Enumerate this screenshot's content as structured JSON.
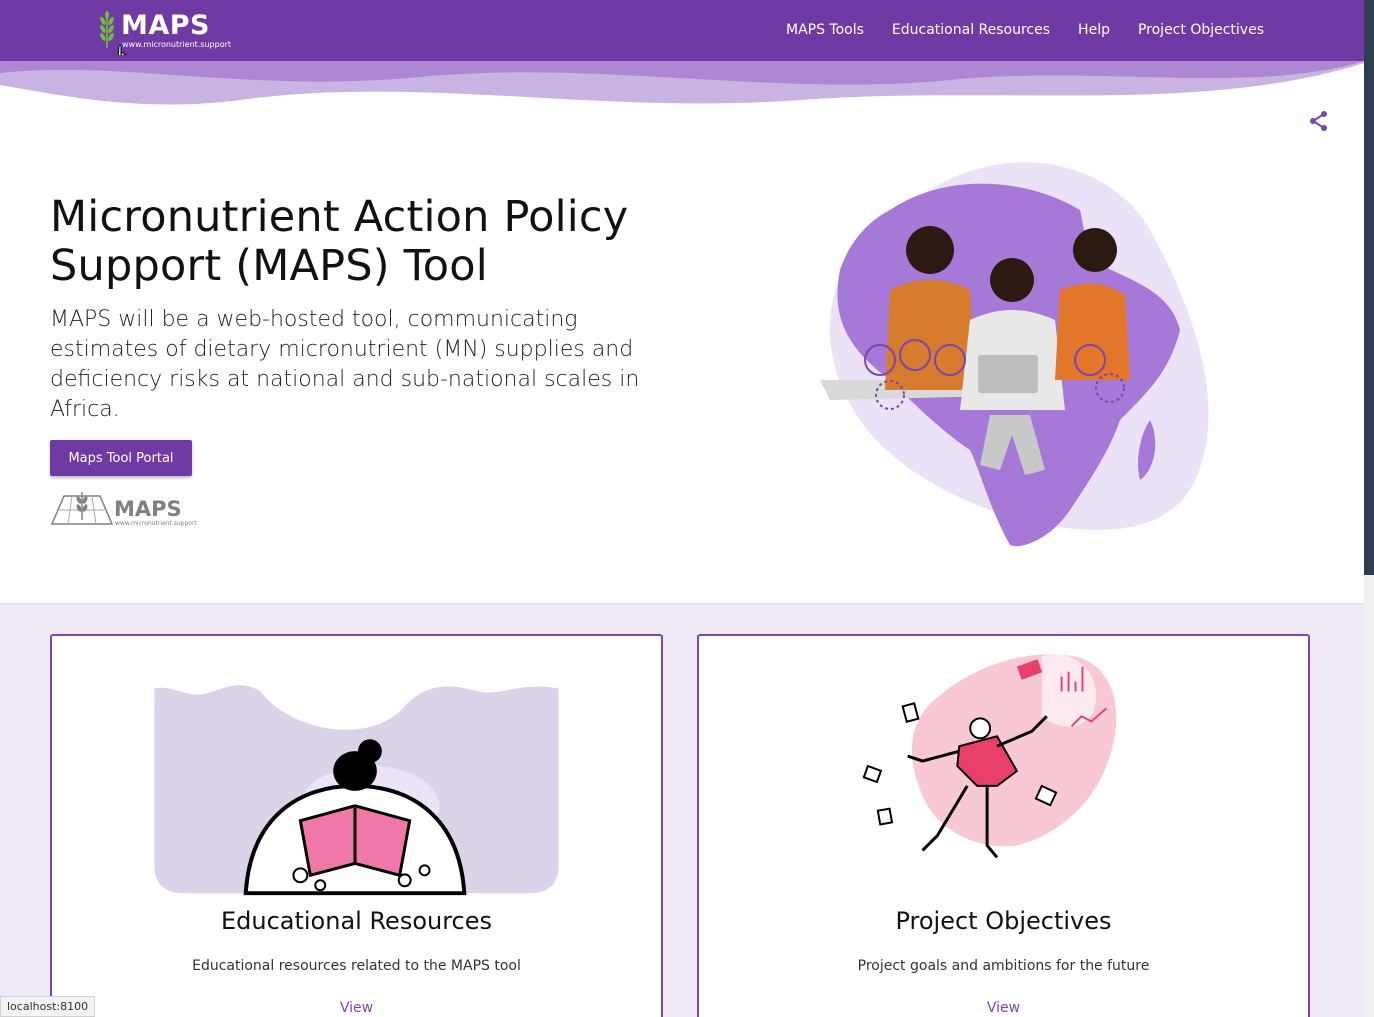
{
  "header": {
    "logo_text": "MAPS",
    "logo_url": "www.micronutrient.support",
    "nav": [
      "MAPS Tools",
      "Educational Resources",
      "Help",
      "Project Objectives"
    ]
  },
  "hero": {
    "title": "Micronutrient Action Policy Support (MAPS) Tool",
    "description": "MAPS will be a web-hosted tool, communicating estimates of dietary micronutrient (MN) supplies and deficiency risks at national and sub-national scales in Africa.",
    "button_label": "Maps Tool Portal",
    "small_logo_text": "MAPS",
    "small_logo_url": "www.micronutrient.support"
  },
  "cards": [
    {
      "title": "Educational Resources",
      "description": "Educational resources related to the MAPS tool",
      "link": "View"
    },
    {
      "title": "Project Objectives",
      "description": "Project goals and ambitions for the future",
      "link": "View"
    }
  ],
  "status_bar": "localhost:8100",
  "colors": {
    "brand_purple": "#6f3aa3",
    "light_purple": "#efeaf6"
  },
  "icons": [
    "leaf-icon",
    "share-icon",
    "hand-cursor-icon"
  ]
}
